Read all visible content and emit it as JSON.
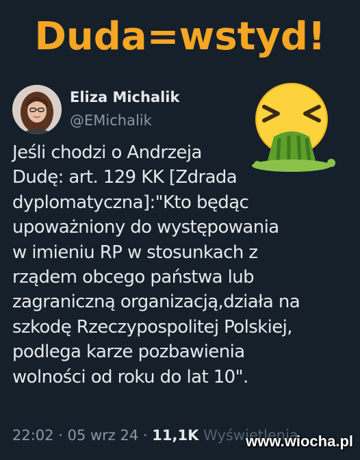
{
  "headline": "Duda=wstyd!",
  "tweet": {
    "author_name": "Eliza Michalik",
    "author_handle": "@EMichalik",
    "avatar_icon": "woman-portrait-avatar",
    "reaction_emoji": "vomiting-face-icon",
    "text_lines": [
      "Jeśli chodzi o Andrzeja",
      "Dudę: art. 129 KK [Zdrada",
      "dyplomatyczna]:\"Kto będąc",
      "upoważniony do występowania",
      "w imieniu RP w stosunkach z",
      "rządem obcego państwa lub",
      "zagraniczną organizacją,działa na",
      "szkodę Rzeczypospolitej Polskiej,",
      "podlega karze pozbawienia",
      "wolności od roku do lat 10\"."
    ],
    "time": "22:02",
    "date": "05 wrz 24",
    "separator": "·",
    "views_count": "11,1K",
    "views_label": "Wyświetlenia"
  },
  "watermark": "www.wiocha.pl",
  "colors": {
    "background": "#15202b",
    "headline": "#f5a623",
    "text": "#e7e9ea",
    "secondary_text": "#8b98a5"
  }
}
